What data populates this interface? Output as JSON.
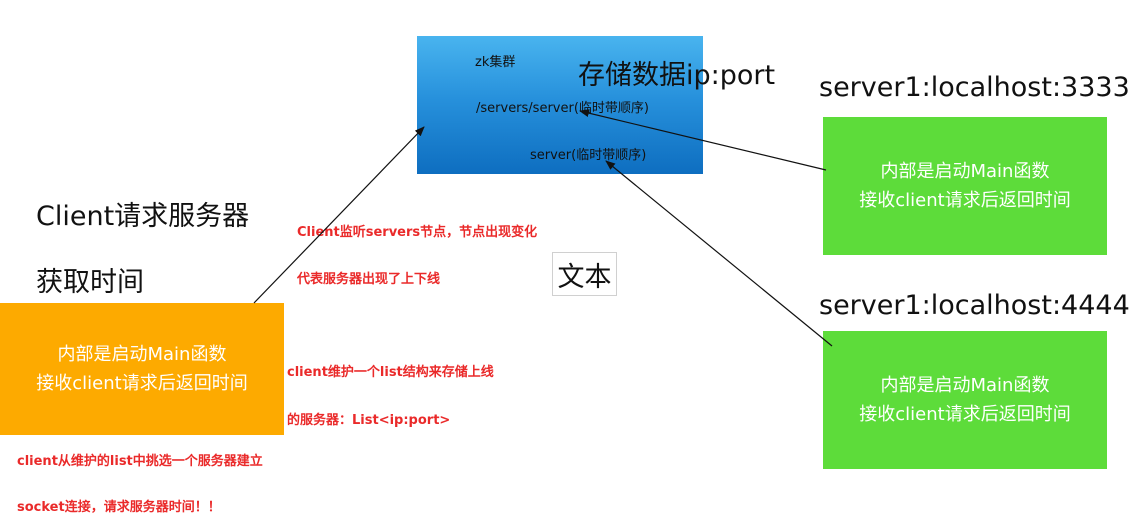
{
  "zk": {
    "title": "zk集群",
    "storage_label": "存储数据ip:port",
    "path1": "/servers/server(临时带顺序)",
    "path2": "server(临时带顺序)"
  },
  "servers": [
    {
      "label": "server1:localhost:3333",
      "line1": "内部是启动Main函数",
      "line2": "接收client请求后返回时间"
    },
    {
      "label": "server1:localhost:4444",
      "line1": "内部是启动Main函数",
      "line2": "接收client请求后返回时间"
    }
  ],
  "client": {
    "title1": "Client请求服务器",
    "title2": "获取时间",
    "line1": "内部是启动Main函数",
    "line2": "接收client请求后返回时间"
  },
  "notes": {
    "watch1": "Client监听servers节点，节点出现变化",
    "watch2": "代表服务器出现了上下线",
    "list1": "client维护一个list结构来存储上线",
    "list2": "的服务器：List<ip:port>",
    "pick1": "client从维护的list中挑选一个服务器建立",
    "pick2": "socket连接，请求服务器时间！！"
  },
  "text_box": "文本",
  "colors": {
    "zk_box": "#2791dc",
    "server_box": "#5ddc3a",
    "client_box": "#fdaa00",
    "note_text": "#ea2a2a"
  }
}
